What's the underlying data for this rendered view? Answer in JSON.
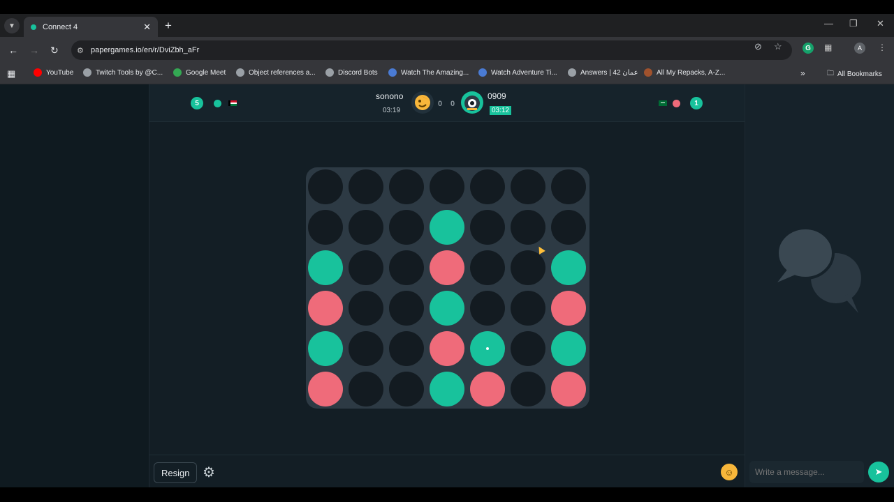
{
  "browser": {
    "tab_title": "Connect 4",
    "url": "papergames.io/en/r/DviZbh_aFr",
    "bookmarks": [
      {
        "label": "YouTube",
        "color": "#ff0000"
      },
      {
        "label": "Twitch Tools by @C...",
        "color": "#9aa0a6"
      },
      {
        "label": "Google Meet",
        "color": "#34a853"
      },
      {
        "label": "Object references a...",
        "color": "#9aa0a6"
      },
      {
        "label": "Discord Bots",
        "color": "#9aa0a6"
      },
      {
        "label": "Watch The Amazing...",
        "color": "#4a7bd4"
      },
      {
        "label": "Watch Adventure Ti...",
        "color": "#4a7bd4"
      },
      {
        "label": "Answers | عمان 42",
        "color": "#9aa0a6"
      },
      {
        "label": "All My Repacks, A-Z...",
        "color": "#a0522d"
      }
    ],
    "all_bookmarks_label": "All Bookmarks"
  },
  "game": {
    "left_badge": "5",
    "right_badge": "1",
    "player1": {
      "name": "sonono",
      "time": "03:19",
      "score": "0"
    },
    "player2": {
      "name": "0909",
      "time": "03:12",
      "score": "0"
    },
    "colors": {
      "teal": "#18c29c",
      "red": "#ef6b7a"
    },
    "board": [
      [
        "e",
        "e",
        "e",
        "e",
        "e",
        "e",
        "e"
      ],
      [
        "e",
        "e",
        "e",
        "t",
        "e",
        "e",
        "e"
      ],
      [
        "t",
        "e",
        "e",
        "r",
        "e",
        "e",
        "t"
      ],
      [
        "r",
        "e",
        "e",
        "t",
        "e",
        "e",
        "r"
      ],
      [
        "t",
        "e",
        "e",
        "r",
        "t",
        "e",
        "t"
      ],
      [
        "r",
        "e",
        "e",
        "t",
        "r",
        "e",
        "r"
      ]
    ],
    "last_move": {
      "row": 4,
      "col": 4
    }
  },
  "footer": {
    "resign_label": "Resign"
  },
  "chat": {
    "placeholder": "Write a message..."
  }
}
